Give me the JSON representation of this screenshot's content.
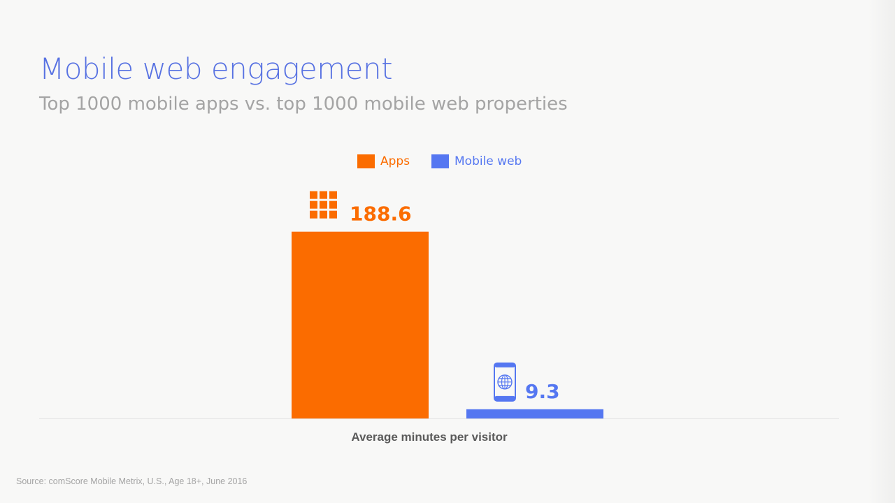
{
  "slide": {
    "title": "Mobile web engagement",
    "subtitle": "Top 1000 mobile apps vs. top 1000 mobile web properties",
    "source": "Source: comScore Mobile Metrix, U.S., Age 18+, June 2016"
  },
  "colors": {
    "title": "#5872e2",
    "apps": "#fb6c00",
    "mobile_web": "#5577f1",
    "axis": "#e2e2e2",
    "muted_text": "#a4a4a4",
    "xlabel": "#5a5a5a"
  },
  "chart_data": {
    "type": "bar",
    "categories": [
      "Apps",
      "Mobile web"
    ],
    "values": [
      188.6,
      9.3
    ],
    "value_labels": [
      "188.6",
      "9.3"
    ],
    "series": [
      {
        "name": "Apps",
        "values": [
          188.6
        ],
        "color": "#fb6c00",
        "icon": "app-grid-icon"
      },
      {
        "name": "Mobile web",
        "values": [
          9.3
        ],
        "color": "#5577f1",
        "icon": "phone-globe-icon"
      }
    ],
    "title": "",
    "xlabel": "Average minutes per visitor",
    "ylabel": "",
    "ylim": [
      0,
      200
    ],
    "grid": false,
    "legend_position": "top-center"
  }
}
